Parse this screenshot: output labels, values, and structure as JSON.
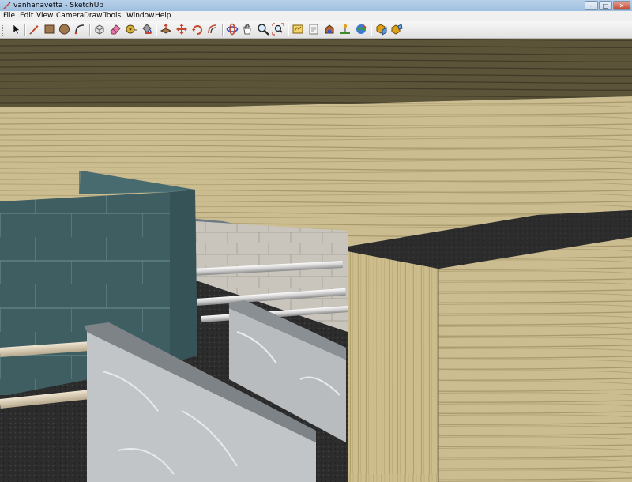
{
  "window": {
    "title": "vanhanavetta - SketchUp",
    "controls": [
      "minimize-icon",
      "maximize-icon",
      "close-icon"
    ]
  },
  "menu": {
    "items": [
      {
        "label": "File"
      },
      {
        "label": "Edit"
      },
      {
        "label": "View"
      },
      {
        "label": "Camera"
      },
      {
        "label": "Draw"
      },
      {
        "label": "Tools"
      },
      {
        "label": "Window"
      },
      {
        "label": "Help"
      }
    ]
  },
  "toolbar": {
    "tools": [
      "select-icon",
      "pencil-line-icon",
      "rectangle-icon",
      "circle-icon",
      "arc-icon",
      "make-component-icon",
      "eraser-icon",
      "tape-measure-icon",
      "paint-bucket-icon",
      "push-pull-icon",
      "move-icon",
      "rotate-icon",
      "offset-icon",
      "orbit-icon",
      "pan-icon",
      "zoom-icon",
      "zoom-extents-icon",
      "get-models-icon",
      "share-model-icon",
      "get-current-view-icon",
      "toggle-terrain-icon",
      "place-model-icon",
      "google-earth-icon",
      "share-component-icon",
      "component-browser-icon"
    ]
  },
  "colors": {
    "accent": "#c4462f",
    "wood": "#c8b98c",
    "tile": "#3f5f63",
    "floor": "#2a2a2a"
  }
}
